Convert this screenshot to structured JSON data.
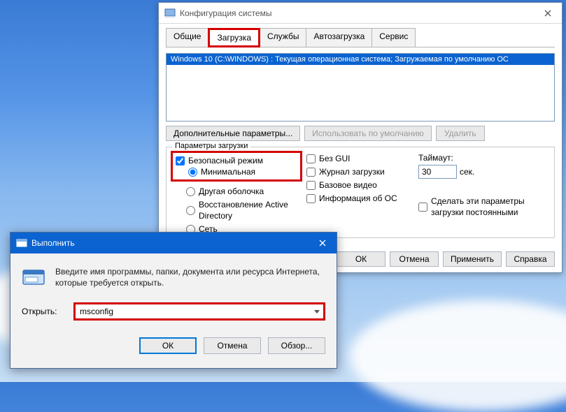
{
  "sysconf": {
    "title": "Конфигурация системы",
    "tabs": [
      "Общие",
      "Загрузка",
      "Службы",
      "Автозагрузка",
      "Сервис"
    ],
    "active_tab_index": 1,
    "boot_entry": "Windows 10 (C:\\WINDOWS) : Текущая операционная система; Загружаемая по умолчанию ОС",
    "btn_adv_params": "Дополнительные параметры...",
    "btn_use_default": "Использовать по умолчанию",
    "btn_delete": "Удалить",
    "group_title": "Параметры загрузки",
    "safe_mode": "Безопасный режим",
    "radio_minimal": "Минимальная",
    "radio_altshell": "Другая оболочка",
    "radio_adrepair": "Восстановление Active Directory",
    "radio_network": "Сеть",
    "no_gui": "Без GUI",
    "boot_log": "Журнал загрузки",
    "base_video": "Базовое видео",
    "os_info": "Информация об ОС",
    "timeout_label": "Таймаут:",
    "timeout_value": "30",
    "timeout_unit": "сек.",
    "persist_params": "Сделать эти параметры загрузки постоянными",
    "ok": "ОК",
    "cancel": "Отмена",
    "apply": "Применить",
    "help": "Справка"
  },
  "run": {
    "title": "Выполнить",
    "desc": "Введите имя программы, папки, документа или ресурса Интернета, которые требуется открыть.",
    "open_label": "Открыть:",
    "value": "msconfig",
    "ok": "ОК",
    "cancel": "Отмена",
    "browse": "Обзор..."
  }
}
